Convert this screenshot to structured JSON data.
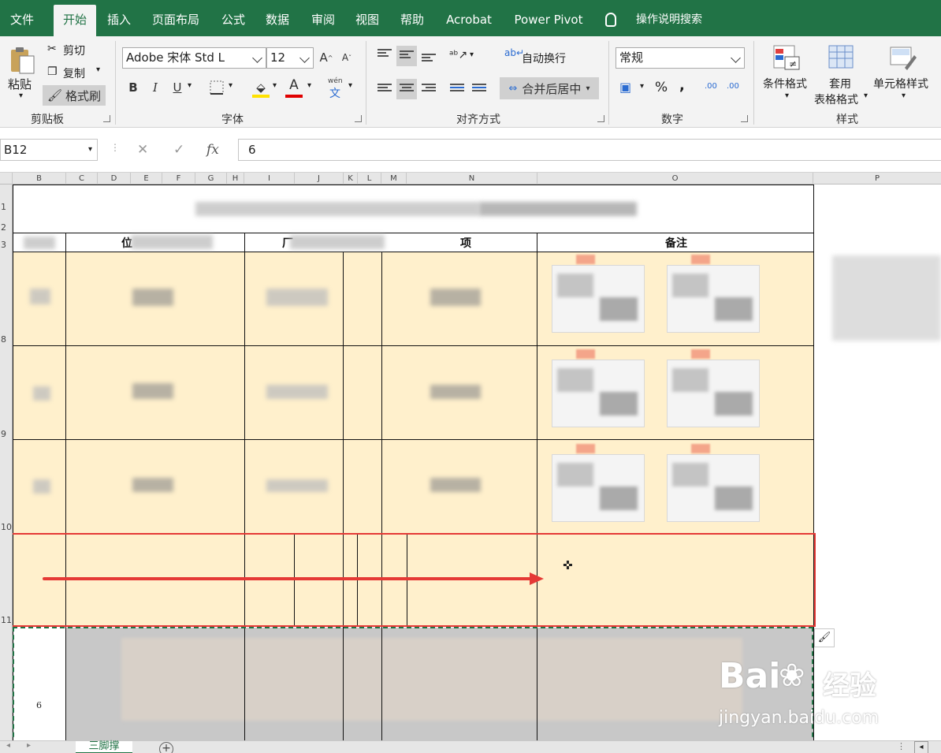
{
  "ribbon_tabs": [
    "文件",
    "开始",
    "插入",
    "页面布局",
    "公式",
    "数据",
    "审阅",
    "视图",
    "帮助",
    "Acrobat",
    "Power Pivot"
  ],
  "active_tab": "开始",
  "tell_me": "操作说明搜索",
  "clipboard": {
    "paste": "粘贴",
    "cut": "剪切",
    "copy": "复制",
    "format_painter": "格式刷",
    "label": "剪贴板"
  },
  "font": {
    "name": "Adobe 宋体 Std L",
    "size": "12",
    "bold": "B",
    "italic": "I",
    "underline": "U",
    "grow": "A",
    "shrink": "A",
    "font_color": "A",
    "phonetic": "wén",
    "phonetic_char": "文",
    "label": "字体"
  },
  "alignment": {
    "wrap_text": "自动换行",
    "merge_center": "合并后居中",
    "label": "对齐方式"
  },
  "number": {
    "format": "常规",
    "percent": "%",
    "comma": ",",
    "inc_decimal": ".00",
    "dec_decimal": ".00",
    "label": "数字"
  },
  "styles": {
    "conditional": "条件格式",
    "table_line1": "套用",
    "table_line2": "表格格式",
    "cell_styles": "单元格样式",
    "label": "样式"
  },
  "formula_bar": {
    "name_box": "B12",
    "fx": "fx",
    "value": "6"
  },
  "columns": [
    "B",
    "C",
    "D",
    "E",
    "F",
    "G",
    "H",
    "I",
    "J",
    "K",
    "L",
    "M",
    "N",
    "O",
    "P"
  ],
  "rows": [
    "1",
    "2",
    "3",
    "8",
    "9",
    "10",
    "11",
    "6"
  ],
  "sheet": {
    "header_remark": "备注",
    "row6_value": "6",
    "col_c_partial": "位",
    "col_i_partial": "厂",
    "col_n_partial": "项"
  },
  "sheet_tab": "三脚撑",
  "add_sheet": "+",
  "watermark": {
    "logo": "Bai",
    "cn": "经验",
    "url": "jingyan.baidu.com"
  },
  "colors": {
    "accent": "#217346",
    "selection": "#e53935",
    "cell_fill": "#fff0cc"
  }
}
